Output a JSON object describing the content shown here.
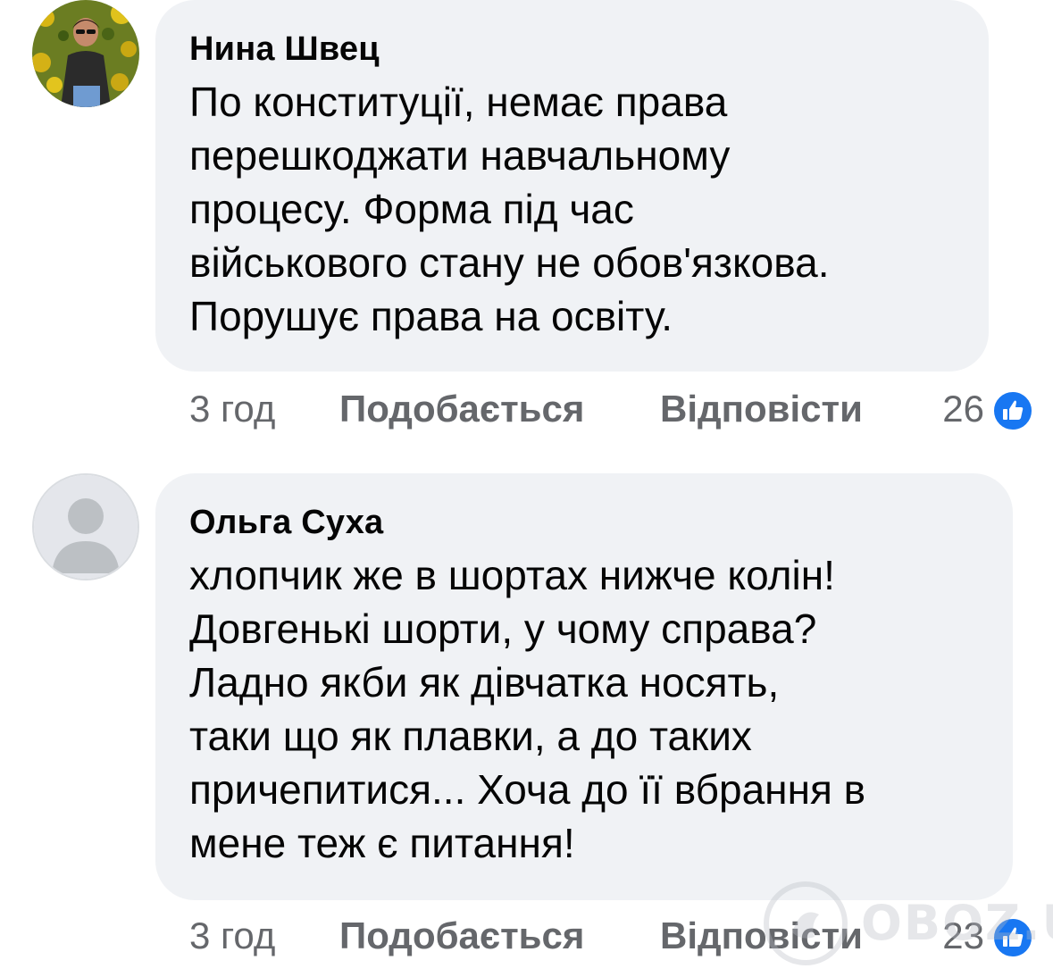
{
  "comments": [
    {
      "author": "Нина Швец",
      "avatar_icon": "user-photo-avatar",
      "text_lines": [
        "По конституції, немає права",
        "перешкоджати навчальному",
        "процесу. Форма під час",
        "військового стану не обов'язкова.",
        "Порушує права на освіту."
      ],
      "time": "3 год",
      "like_label": "Подобається",
      "reply_label": "Відповісти",
      "reaction_count": "26",
      "reaction_icon": "thumbs-up-icon"
    },
    {
      "author": "Ольга Суха",
      "avatar_icon": "default-user-silhouette-avatar",
      "text_lines": [
        "хлопчик же в шортах нижче колін!",
        "Довгенькі шорти, у чому справа?",
        "Ладно якби як дівчатка носять,",
        "таки що як плавки, а до таких",
        "причепитися... Хоча до її вбрання в",
        "мене теж є питання!"
      ],
      "time": "3 год",
      "like_label": "Подобається",
      "reply_label": "Відповісти",
      "reaction_count": "23",
      "reaction_icon": "thumbs-up-icon"
    }
  ],
  "watermark": {
    "text": "OBOZ.UA",
    "icon": "oboz-logo-icon"
  },
  "colors": {
    "bubble": "#f0f2f5",
    "text": "#050505",
    "meta": "#65676b",
    "like_blue": "#1877f2"
  }
}
